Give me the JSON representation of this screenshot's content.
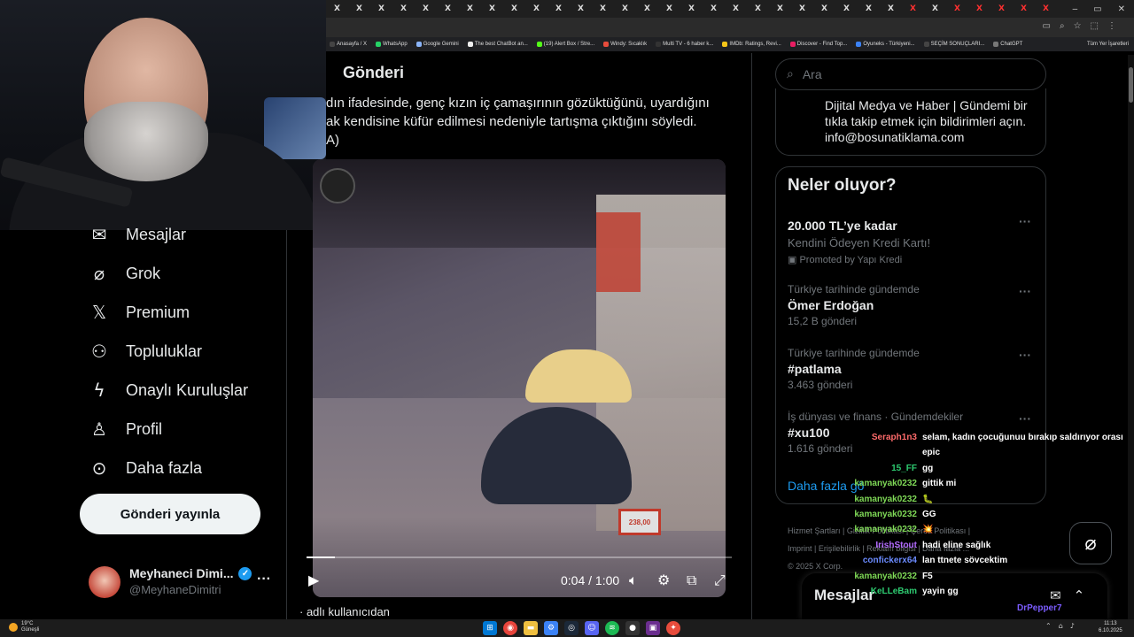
{
  "browser": {
    "tab_count": 33,
    "tab_label": "X",
    "window_controls": [
      "–",
      "▭",
      "✕"
    ],
    "bookmarks": [
      {
        "label": "Anasayfa / X",
        "color": "#444"
      },
      {
        "label": "WhatsApp",
        "color": "#25d366"
      },
      {
        "label": "Google Gemini",
        "color": "#8ab4f8"
      },
      {
        "label": "The best ChatBot an...",
        "color": "#eee"
      },
      {
        "label": "(19) Alert Box / Stre...",
        "color": "#53fc18"
      },
      {
        "label": "Windy: Sıcaklık",
        "color": "#e74c3c"
      },
      {
        "label": "Multi TV - 6 haber k...",
        "color": "#333"
      },
      {
        "label": "IMDb: Ratings, Revi...",
        "color": "#f5c518"
      },
      {
        "label": "Discover - Find Top...",
        "color": "#e91e63"
      },
      {
        "label": "Oyuneks - Türkiyeni...",
        "color": "#3b82f6"
      },
      {
        "label": "SEÇİM SONUÇLARI...",
        "color": "#444"
      },
      {
        "label": "ChatGPT",
        "color": "#777"
      }
    ],
    "bookmarks_other": "Tüm Yer İşaretleri"
  },
  "nav": {
    "items": [
      {
        "label": "Mesajlar",
        "icon": "mail-icon"
      },
      {
        "label": "Grok",
        "icon": "grok-icon"
      },
      {
        "label": "Premium",
        "icon": "x-logo-icon"
      },
      {
        "label": "Topluluklar",
        "icon": "communities-icon"
      },
      {
        "label": "Onaylı Kuruluşlar",
        "icon": "lightning-icon"
      },
      {
        "label": "Profil",
        "icon": "person-icon"
      },
      {
        "label": "Daha fazla",
        "icon": "more-circle-icon"
      }
    ],
    "post_button": "Gönderi yayınla",
    "profile": {
      "name": "Meyhaneci Dimi...",
      "handle": "@MeyhaneDimitri"
    }
  },
  "post": {
    "header": "Gönderi",
    "text_lines": [
      "dın ifadesinde, genç kızın iç çamaşırının gözüktüğünü, uyardığını",
      "ak kendisine küfür edilmesi nedeniyle tartışma çıktığını söyledi.",
      "A)"
    ],
    "video": {
      "current": "0:04",
      "duration": "1:00",
      "progress": 0.067,
      "price_tag": "238,00"
    },
    "below": "adlı kullanıcıdan"
  },
  "sidebar": {
    "search_placeholder": "Ara",
    "info_lines": [
      "Dijital Medya ve Haber | Gündemi bir",
      "tıkla takip etmek için bildirimleri açın.",
      "info@bosunatiklama.com"
    ],
    "trends_title": "Neler oluyor?",
    "trends": [
      {
        "category": "",
        "name": "20.000 TL’ye kadar",
        "sub": "Kendini Ödeyen Kredi Kartı!",
        "promo": "Promoted by Yapı Kredi"
      },
      {
        "category": "Türkiye tarihinde gündemde",
        "name": "Ömer Erdoğan",
        "count": "15,2 B gönderi"
      },
      {
        "category": "Türkiye tarihinde gündemde",
        "name": "#patlama",
        "count": "3.463 gönderi"
      },
      {
        "category": "İş dünyası ve finans · Gündemdekiler",
        "name": "#xu100",
        "count": "1.616 gönderi"
      }
    ],
    "show_more": "Daha fazla gö",
    "footer_line1": "Hizmet Şartları  |  Gizlilik Politikası  |  Çerez Politikası  |",
    "footer_line2": "Imprint  |  Erişilebilirlik  |  Reklam bilgisi  |  Daha fazla ...",
    "footer_line3": "© 2025 X Corp.",
    "messages_title": "Mesajlar"
  },
  "chat": [
    {
      "user": "Seraph1n3",
      "color": "#ff6b6b",
      "msg": "selam, kadın çocuğunuu bırakıp saldırıyor orası"
    },
    {
      "user": "",
      "color": "#fff",
      "msg": "epic"
    },
    {
      "user": "15_FF",
      "color": "#2ecc71",
      "msg": "gg"
    },
    {
      "user": "kamanyak0232",
      "color": "#7fd957",
      "msg": "gittik mi"
    },
    {
      "user": "kamanyak0232",
      "color": "#7fd957",
      "msg": "🐛"
    },
    {
      "user": "kamanyak0232",
      "color": "#7fd957",
      "msg": "GG"
    },
    {
      "user": "kamanyak0232",
      "color": "#7fd957",
      "msg": "💥"
    },
    {
      "user": "IrishStout",
      "color": "#b36bff",
      "msg": "hadi eline sağlık"
    },
    {
      "user": "confickerx64",
      "color": "#6b8bff",
      "msg": "lan ttnete sövcektim"
    },
    {
      "user": "kamanyak0232",
      "color": "#7fd957",
      "msg": "F5"
    },
    {
      "user": "KeLLeBam",
      "color": "#2ecc71",
      "msg": "yayin gg"
    }
  ],
  "chat_extra_user": "DrPepper7",
  "taskbar": {
    "weather_temp": "19°C",
    "weather_desc": "Güneşli",
    "time": "11:13",
    "date": "6.10.2025"
  }
}
